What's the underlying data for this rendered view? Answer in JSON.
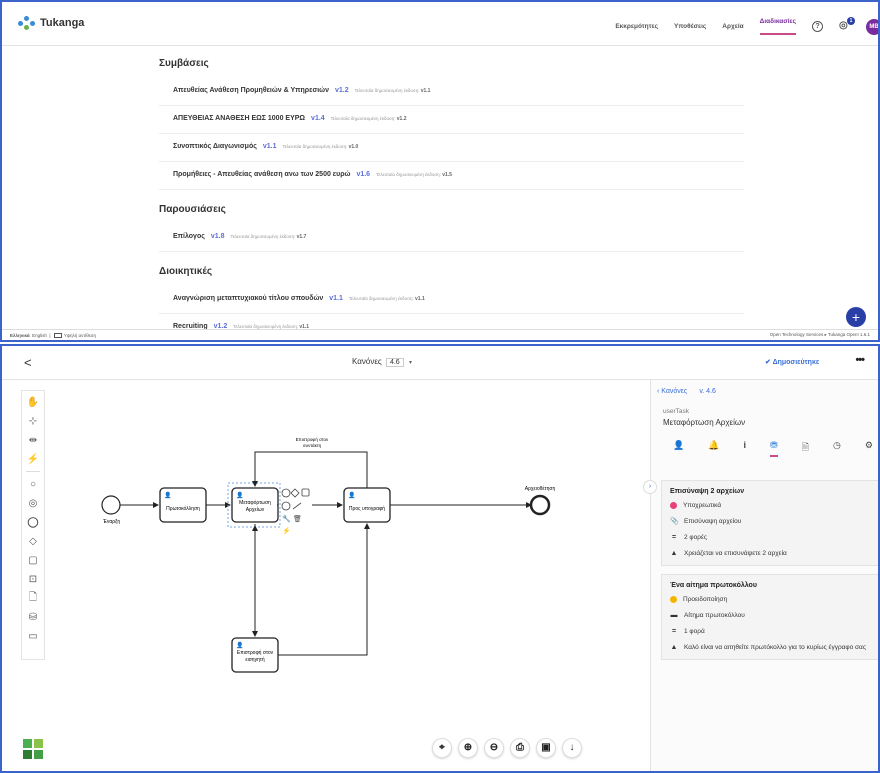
{
  "top": {
    "logo": "Tukanga",
    "nav": [
      "Εκκρεμότητες",
      "Υποθέσεις",
      "Αρχεία",
      "Διαδικασίες"
    ],
    "nav_active": "Διαδικασίες",
    "notifications_count": "1",
    "avatar": "MB",
    "sections": [
      {
        "title": "Συμβάσεις",
        "rows": [
          {
            "name": "Απευθείας Ανάθεση Προμηθειών & Υπηρεσιών",
            "ver": "v1.2",
            "last_label": "Τελευταία δημοσιευμένη έκδοση:",
            "last": "v1.1"
          },
          {
            "name": "ΑΠΕΥΘΕΙΑΣ ΑΝΑΘΕΣΗ ΕΩΣ 1000 ΕΥΡΩ",
            "ver": "v1.4",
            "last_label": "Τελευταία δημοσιευμένη έκδοση:",
            "last": "v1.2"
          },
          {
            "name": "Συνοπτικός Διαγωνισμός",
            "ver": "v1.1",
            "last_label": "Τελευταία δημοσιευμένη έκδοση:",
            "last": "v1.0"
          },
          {
            "name": "Προμήθειες - Απευθείας ανάθεση ανω των 2500 ευρώ",
            "ver": "v1.6",
            "last_label": "Τελευταία δημοσιευμένη έκδοση:",
            "last": "v1.5"
          }
        ]
      },
      {
        "title": "Παρουσιάσεις",
        "rows": [
          {
            "name": "Επίλογος",
            "ver": "v1.8",
            "last_label": "Τελευταία δημοσιευμένη έκδοση:",
            "last": "v1.7"
          }
        ]
      },
      {
        "title": "Διοικητικές",
        "rows": [
          {
            "name": "Αναγνώριση μεταπτυχιακού τίτλου σπουδών",
            "ver": "v1.1",
            "last_label": "Τελευταία δημοσιευμένη έκδοση:",
            "last": "v1.1"
          },
          {
            "name": "Recruiting",
            "ver": "v1.2",
            "last_label": "Τελευταία δημοσιευμένη έκδοση:",
            "last": "v1.1"
          }
        ]
      }
    ],
    "fab": "+",
    "footer": {
      "lang_el": "Ελληνικά",
      "lang_en": "English",
      "contrast": "Υψηλή αντίθεση",
      "right": "Open Technology Services  ▸  Tukanga Open!  1.6.1"
    }
  },
  "editor": {
    "back": "<",
    "title": "Κανόνες",
    "version": "4.6",
    "caret": "▾",
    "published": "Δημοσιεύτηκε",
    "more": "•••",
    "diagram": {
      "start_label": "Έναρξη",
      "end_label": "Αρχειοθέτηση",
      "task1": "Πρωτοκόλληση",
      "task2_l1": "Μεταφόρτωση",
      "task2_l2": "Αρχείων",
      "task3": "Προς υπογραφή",
      "task4_l1": "Επιστροφή στον",
      "task4_l2": "εισηγητή",
      "loop_l1": "Επιστροφή στον",
      "loop_l2": "συντάκτη"
    },
    "panel": {
      "back": "Κανόνες",
      "version": "v. 4.6",
      "type": "userTask",
      "name": "Μεταφόρτωση Αρχείων",
      "card1": {
        "title": "Επισύναψη 2 αρχείων",
        "level": "Υποχρεωτικά",
        "level_color": "#e8407a",
        "action": "Επισύναψη αρχείου",
        "count": "2 φορές",
        "message": "Χρειάζεται να επισυνάψετε 2 αρχεία"
      },
      "card2": {
        "title": "Ένα αίτημα πρωτοκόλλου",
        "level": "Προειδοποίηση",
        "level_color": "#f4b400",
        "action": "Αίτημα πρωτοκόλλου",
        "count": "1 φορά",
        "message": "Καλό είναι να αιτηθείτε πρωτόκολλο για το κυρίως έγγραφο σας"
      }
    }
  }
}
